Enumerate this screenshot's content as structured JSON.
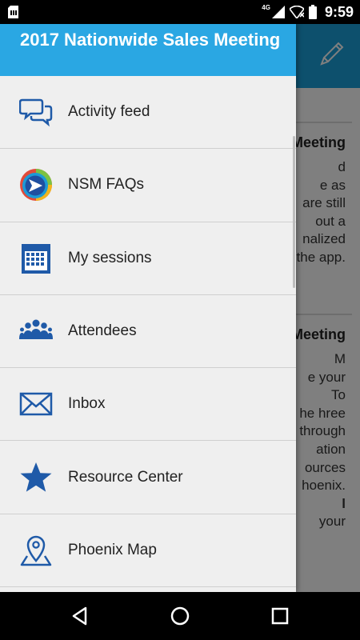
{
  "status_bar": {
    "network": "4G",
    "time": "9:59"
  },
  "drawer": {
    "title": "2017 Nationwide Sales Meeting",
    "items": [
      {
        "label": "Activity feed",
        "icon": "chat-bubbles-icon"
      },
      {
        "label": "NSM FAQs",
        "icon": "nsm-logo-icon"
      },
      {
        "label": "My sessions",
        "icon": "calendar-icon"
      },
      {
        "label": "Attendees",
        "icon": "people-icon"
      },
      {
        "label": "Inbox",
        "icon": "envelope-icon"
      },
      {
        "label": "Resource Center",
        "icon": "star-icon"
      },
      {
        "label": "Phoenix Map",
        "icon": "map-pin-icon"
      }
    ]
  },
  "background": {
    "posts": [
      {
        "title": "Meeting",
        "lines": [
          "d",
          "e as",
          "are still",
          "out a",
          "nalized",
          "the app."
        ]
      },
      {
        "title": "Meeting",
        "lines": [
          "M",
          "e your",
          "To",
          "he hree",
          "through",
          "ation",
          "ources",
          "hoenix.",
          "l",
          "your"
        ]
      }
    ]
  },
  "colors": {
    "drawer_header": "#2aa7e3",
    "app_header": "#1aa0db",
    "icon_blue": "#1f5aa8",
    "drawer_bg": "#efefef"
  }
}
